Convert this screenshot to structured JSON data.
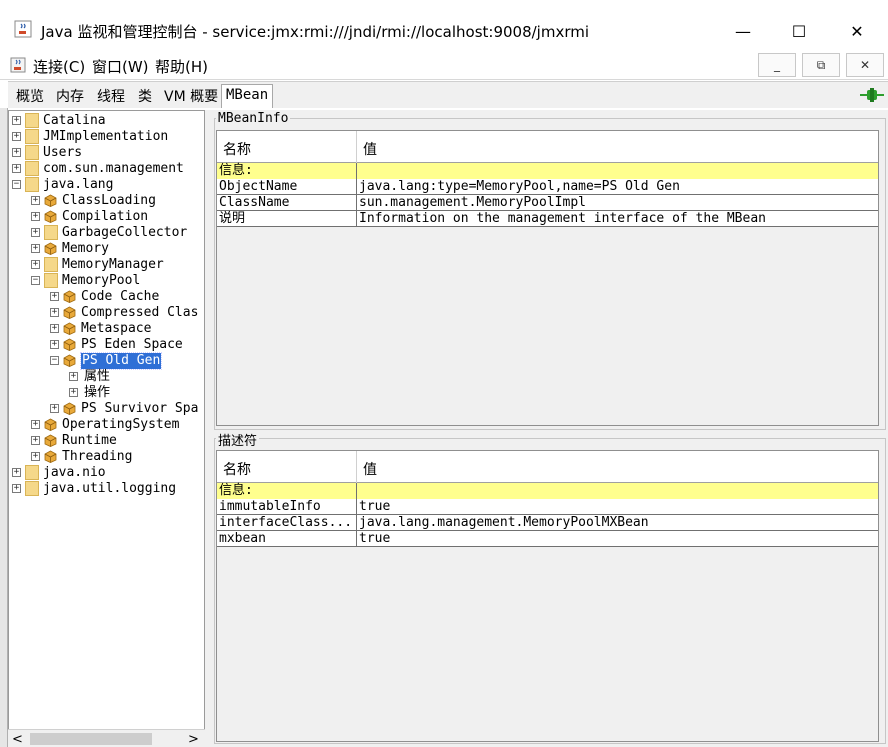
{
  "window": {
    "title": "Java 监视和管理控制台 - service:jmx:rmi:///jndi/rmi://localhost:9008/jmxrmi",
    "minimize": "—",
    "maximize": "☐",
    "close": "✕"
  },
  "menu": {
    "connect": "连接(C)",
    "window": "窗口(W)",
    "help": "帮助(H)",
    "mdi_min": "_",
    "mdi_restore": "⧉",
    "mdi_close": "✕"
  },
  "tabs": [
    "概览",
    "内存",
    "线程",
    "类",
    "VM 概要",
    "MBean"
  ],
  "active_tab": "MBean",
  "tree": {
    "items": [
      {
        "label": "Catalina",
        "level": 0,
        "type": "folder",
        "toggle": "+"
      },
      {
        "label": "JMImplementation",
        "level": 0,
        "type": "folder",
        "toggle": "+"
      },
      {
        "label": "Users",
        "level": 0,
        "type": "folder",
        "toggle": "+"
      },
      {
        "label": "com.sun.management",
        "level": 0,
        "type": "folder",
        "toggle": "+"
      },
      {
        "label": "java.lang",
        "level": 0,
        "type": "folder",
        "toggle": "−"
      },
      {
        "label": "ClassLoading",
        "level": 1,
        "type": "bean",
        "toggle": "+"
      },
      {
        "label": "Compilation",
        "level": 1,
        "type": "bean",
        "toggle": "+"
      },
      {
        "label": "GarbageCollector",
        "level": 1,
        "type": "folder",
        "toggle": "+"
      },
      {
        "label": "Memory",
        "level": 1,
        "type": "bean",
        "toggle": "+"
      },
      {
        "label": "MemoryManager",
        "level": 1,
        "type": "folder",
        "toggle": "+"
      },
      {
        "label": "MemoryPool",
        "level": 1,
        "type": "folder",
        "toggle": "−"
      },
      {
        "label": "Code Cache",
        "level": 2,
        "type": "bean",
        "toggle": "+"
      },
      {
        "label": "Compressed Clas",
        "level": 2,
        "type": "bean",
        "toggle": "+"
      },
      {
        "label": "Metaspace",
        "level": 2,
        "type": "bean",
        "toggle": "+"
      },
      {
        "label": "PS Eden Space",
        "level": 2,
        "type": "bean",
        "toggle": "+"
      },
      {
        "label": "PS Old Gen",
        "level": 2,
        "type": "bean",
        "toggle": "−",
        "selected": true
      },
      {
        "label": "属性",
        "level": 3,
        "type": "none",
        "toggle": "+"
      },
      {
        "label": "操作",
        "level": 3,
        "type": "none",
        "toggle": "+"
      },
      {
        "label": "PS Survivor Spa",
        "level": 2,
        "type": "bean",
        "toggle": "+"
      },
      {
        "label": "OperatingSystem",
        "level": 1,
        "type": "bean",
        "toggle": "+"
      },
      {
        "label": "Runtime",
        "level": 1,
        "type": "bean",
        "toggle": "+"
      },
      {
        "label": "Threading",
        "level": 1,
        "type": "bean",
        "toggle": "+"
      },
      {
        "label": "java.nio",
        "level": 0,
        "type": "folder",
        "toggle": "+"
      },
      {
        "label": "java.util.logging",
        "level": 0,
        "type": "folder",
        "toggle": "+"
      }
    ],
    "scroll_left": "<",
    "scroll_right": ">"
  },
  "mbeaninfo": {
    "title": "MBeanInfo",
    "col_name": "名称",
    "col_value": "值",
    "info_label": "信息:",
    "rows": [
      {
        "name": "ObjectName",
        "value": "java.lang:type=MemoryPool,name=PS Old Gen"
      },
      {
        "name": "ClassName",
        "value": "sun.management.MemoryPoolImpl"
      },
      {
        "name": "说明",
        "value": "Information on the management interface of the MBean"
      }
    ]
  },
  "descriptor": {
    "title": "描述符",
    "col_name": "名称",
    "col_value": "值",
    "info_label": "信息:",
    "rows": [
      {
        "name": "immutableInfo",
        "value": "true"
      },
      {
        "name": "interfaceClass...",
        "value": "java.lang.management.MemoryPoolMXBean"
      },
      {
        "name": "mxbean",
        "value": "true"
      }
    ]
  },
  "colors": {
    "selection": "#2f6fd6",
    "info_row": "#ffff8e",
    "connected_icon": "#2e9e2e"
  }
}
